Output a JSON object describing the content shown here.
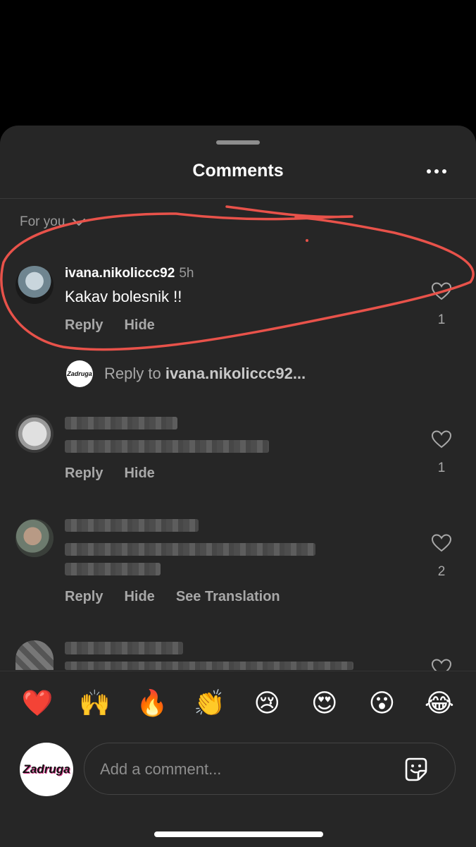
{
  "header": {
    "title": "Comments",
    "more_icon": "more-horizontal-icon"
  },
  "sort": {
    "label": "For you",
    "icon": "chevron-down-icon"
  },
  "comments": [
    {
      "username": "ivana.nikoliccc92",
      "time": "5h",
      "text": "Kakav bolesnik !!",
      "reply": "Reply",
      "hide": "Hide",
      "likes": "1"
    },
    {
      "username": "",
      "text": "",
      "reply": "Reply",
      "hide": "Hide",
      "likes": "1",
      "blurred": true
    },
    {
      "username": "",
      "text": "",
      "reply": "Reply",
      "hide": "Hide",
      "see_translation": "See Translation",
      "likes": "2",
      "blurred": true
    },
    {
      "username": "",
      "text": "",
      "blurred": true
    }
  ],
  "reply_prompt": {
    "prefix": "Reply to ",
    "username": "ivana.nikoliccc92..."
  },
  "emoji_bar": [
    "❤️",
    "🙌",
    "🔥",
    "👏",
    "😢",
    "😍",
    "😮",
    "😂"
  ],
  "composer": {
    "placeholder": "Add a comment...",
    "avatar_text": "Zadruga",
    "sticker_icon": "sticker-icon"
  },
  "colors": {
    "sheet": "#262626",
    "annotation": "#e8524a"
  }
}
